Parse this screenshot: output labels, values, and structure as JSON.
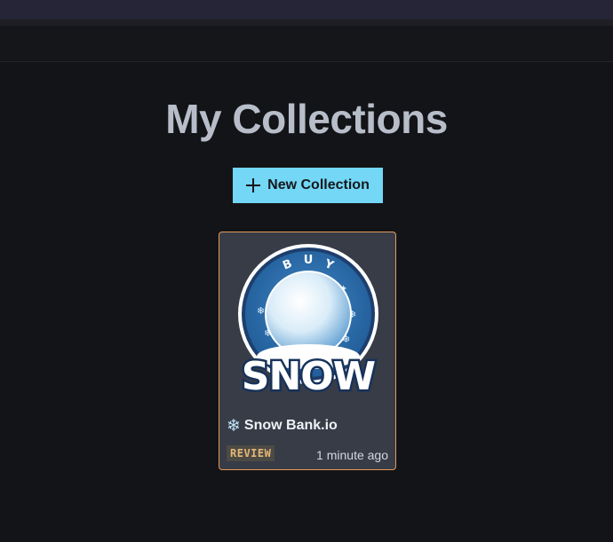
{
  "page": {
    "title": "My Collections",
    "new_button_label": "New Collection"
  },
  "collections": [
    {
      "icon": "snowflake-icon",
      "icon_glyph": "❄",
      "name": "Snow Bank.io",
      "status": "REVIEW",
      "updated": "1 minute ago",
      "logo_top_text": "BUY",
      "logo_main_text": "SNOW"
    }
  ],
  "colors": {
    "accent": "#73d7f5",
    "card_border": "#e59a5b",
    "status_text": "#e6b877"
  }
}
